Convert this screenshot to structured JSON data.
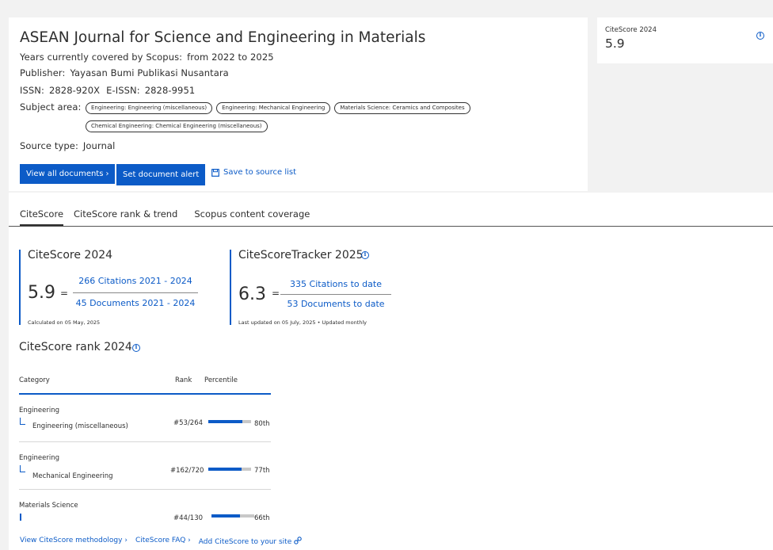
{
  "source": {
    "title": "ASEAN Journal for Science and Engineering in Materials",
    "years_label": "Years currently covered by Scopus:",
    "years_value": "from 2022 to 2025",
    "publisher_label": "Publisher:",
    "publisher_value": "Yayasan Bumi Publikasi Nusantara",
    "issn_label": "ISSN:",
    "issn_value": "2828-920X",
    "eissn_label": "E-ISSN:",
    "eissn_value": "2828-9951",
    "subject_label": "Subject area:",
    "subject_areas": [
      "Engineering: Engineering (miscellaneous)",
      "Engineering: Mechanical Engineering",
      "Materials Science: Ceramics and Composites",
      "Chemical Engineering: Chemical Engineering (miscellaneous)"
    ],
    "source_type_label": "Source type:",
    "source_type_value": "Journal",
    "view_all_label": "View all documents",
    "set_alert_label": "Set document alert",
    "save_label": "Save to source list"
  },
  "side_card": {
    "label": "CiteScore 2024",
    "value": "5.9"
  },
  "tabs": [
    "CiteScore",
    "CiteScore rank & trend",
    "Scopus content coverage"
  ],
  "citescore": {
    "title": "CiteScore 2024",
    "value": "5.9",
    "eq": "=",
    "numerator": "266 Citations 2021 - 2024",
    "denominator": "45 Documents 2021 - 2024",
    "note": "Calculated on 05 May, 2025"
  },
  "tracker": {
    "title": "CiteScoreTracker 2025",
    "value": "6.3",
    "eq": "=",
    "numerator": "335 Citations to date",
    "denominator": "53 Documents to date",
    "note": "Last updated on 05 July, 2025 • Updated monthly"
  },
  "rank": {
    "title": "CiteScore rank 2024",
    "headers": {
      "category": "Category",
      "rank": "Rank",
      "percentile": "Percentile"
    },
    "rows": [
      {
        "category": "Engineering",
        "subcategory": "Engineering (miscellaneous)",
        "rank": "#53/264",
        "percentile": "80th",
        "pct_value": 80
      },
      {
        "category": "Engineering",
        "subcategory": "Mechanical Engineering",
        "rank": "#162/720",
        "percentile": "77th",
        "pct_value": 77
      },
      {
        "category": "Materials Science",
        "subcategory": "",
        "rank": "#44/130",
        "percentile": "66th",
        "pct_value": 66
      }
    ]
  },
  "footer": {
    "methodology": "View CiteScore methodology",
    "faq": "CiteScore FAQ",
    "add": "Add CiteScore to your site"
  },
  "colors": {
    "accent": "#0c5bc7",
    "background": "#f2f2f2",
    "bar_track": "#c8c8c8"
  }
}
